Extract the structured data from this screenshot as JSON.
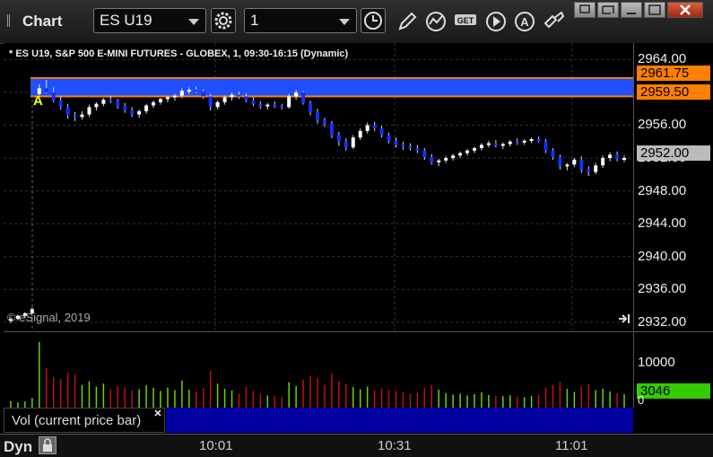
{
  "window": {
    "title": "Chart",
    "symbol": "ES U19",
    "interval": "1"
  },
  "chart": {
    "title": "* ES U19, S&P 500 E-MINI FUTURES - GLOBEX, 1, 09:30-16:15 (Dynamic)",
    "copyright": "© eSignal, 2019",
    "marker": "A",
    "price_ticks": [
      "2964.00",
      "2960.00",
      "2956.00",
      "2952.00",
      "2948.00",
      "2944.00",
      "2940.00",
      "2936.00",
      "2932.00"
    ],
    "zone_high": "2961.75",
    "zone_low": "2959.50",
    "last_price": "2952.00"
  },
  "volume": {
    "tick": "10000",
    "zero": "0",
    "last_volume": "3046",
    "legend": "Vol (current price bar)"
  },
  "status": {
    "mode": "Dyn",
    "times": [
      "10:01",
      "10:31",
      "11:01"
    ]
  },
  "colors": {
    "zone": "#1f4fff",
    "zone_border": "#ff8000",
    "up_volume": "#6cd400",
    "down_volume": "#c01010",
    "last_price_tag": "#bbbbbb",
    "volume_tag": "#33cc00"
  },
  "chart_data": {
    "type": "candlestick",
    "price_range": [
      2931,
      2966
    ],
    "volume_range": [
      0,
      16000
    ],
    "bars": [
      [
        2932.2,
        2932.6,
        2931.9,
        2932.4,
        1500
      ],
      [
        2932.4,
        2932.9,
        2932.2,
        2932.8,
        1200
      ],
      [
        2932.8,
        2933.2,
        2932.5,
        2933.1,
        1400
      ],
      [
        2933.1,
        2933.8,
        2932.9,
        2933.6,
        2200
      ],
      [
        2959.8,
        2961.0,
        2959.6,
        2960.5,
        15000
      ],
      [
        2960.5,
        2961.5,
        2959.9,
        2960.0,
        9000
      ],
      [
        2960.0,
        2960.6,
        2958.8,
        2959.0,
        7000
      ],
      [
        2959.0,
        2959.5,
        2957.9,
        2958.2,
        6500
      ],
      [
        2958.2,
        2958.6,
        2956.8,
        2957.2,
        8000
      ],
      [
        2957.2,
        2957.6,
        2956.5,
        2957.0,
        7500
      ],
      [
        2957.0,
        2957.7,
        2956.7,
        2957.3,
        5200
      ],
      [
        2957.3,
        2958.5,
        2957.0,
        2958.2,
        6000
      ],
      [
        2958.2,
        2958.8,
        2957.8,
        2958.6,
        4800
      ],
      [
        2958.6,
        2959.3,
        2958.3,
        2959.1,
        5500
      ],
      [
        2959.1,
        2959.6,
        2958.7,
        2958.9,
        4200
      ],
      [
        2958.9,
        2959.2,
        2958.0,
        2958.3,
        5000
      ],
      [
        2958.3,
        2958.7,
        2957.5,
        2957.8,
        4600
      ],
      [
        2957.8,
        2958.2,
        2957.0,
        2957.3,
        3900
      ],
      [
        2957.3,
        2957.9,
        2956.9,
        2957.7,
        4200
      ],
      [
        2957.7,
        2958.6,
        2957.4,
        2958.4,
        5100
      ],
      [
        2958.4,
        2959.0,
        2958.1,
        2958.8,
        4500
      ],
      [
        2958.8,
        2959.3,
        2958.5,
        2959.2,
        3800
      ],
      [
        2959.2,
        2959.6,
        2958.8,
        2959.4,
        4600
      ],
      [
        2959.4,
        2959.8,
        2959.0,
        2959.6,
        4000
      ],
      [
        2959.6,
        2960.5,
        2959.3,
        2960.2,
        6200
      ],
      [
        2960.2,
        2960.6,
        2959.8,
        2960.3,
        4100
      ],
      [
        2960.3,
        2960.7,
        2959.9,
        2960.1,
        3600
      ],
      [
        2960.1,
        2960.4,
        2959.2,
        2959.5,
        4400
      ],
      [
        2959.5,
        2959.8,
        2957.8,
        2958.2,
        8500
      ],
      [
        2958.2,
        2959.0,
        2957.9,
        2958.8,
        5500
      ],
      [
        2958.8,
        2959.6,
        2958.5,
        2959.4,
        4300
      ],
      [
        2959.4,
        2960.0,
        2959.0,
        2959.7,
        3900
      ],
      [
        2959.7,
        2960.1,
        2959.2,
        2959.5,
        3200
      ],
      [
        2959.5,
        2959.9,
        2958.8,
        2959.0,
        4700
      ],
      [
        2959.0,
        2959.4,
        2958.3,
        2958.6,
        3800
      ],
      [
        2958.6,
        2958.9,
        2958.0,
        2958.3,
        3100
      ],
      [
        2958.3,
        2958.7,
        2957.9,
        2958.5,
        2800
      ],
      [
        2958.5,
        2958.9,
        2958.1,
        2958.3,
        2600
      ],
      [
        2958.3,
        2958.6,
        2957.9,
        2958.2,
        2400
      ],
      [
        2958.2,
        2959.8,
        2958.0,
        2959.5,
        5800
      ],
      [
        2959.5,
        2960.3,
        2959.1,
        2960.0,
        4900
      ],
      [
        2960.0,
        2960.2,
        2958.5,
        2958.7,
        6400
      ],
      [
        2958.7,
        2959.0,
        2957.2,
        2957.6,
        7200
      ],
      [
        2957.6,
        2958.0,
        2956.2,
        2956.6,
        6800
      ],
      [
        2956.6,
        2956.9,
        2955.8,
        2956.2,
        5200
      ],
      [
        2956.2,
        2956.5,
        2954.4,
        2954.8,
        7800
      ],
      [
        2954.8,
        2955.2,
        2953.5,
        2954.0,
        6100
      ],
      [
        2954.0,
        2954.4,
        2952.9,
        2953.3,
        5400
      ],
      [
        2953.3,
        2954.8,
        2953.1,
        2954.5,
        4700
      ],
      [
        2954.5,
        2955.6,
        2954.2,
        2955.3,
        4200
      ],
      [
        2955.3,
        2956.3,
        2955.0,
        2956.0,
        4800
      ],
      [
        2956.0,
        2956.4,
        2955.3,
        2955.6,
        3900
      ],
      [
        2955.6,
        2955.9,
        2954.5,
        2954.8,
        4400
      ],
      [
        2954.8,
        2955.1,
        2953.8,
        2954.1,
        4100
      ],
      [
        2954.1,
        2954.5,
        2953.3,
        2953.6,
        3800
      ],
      [
        2953.6,
        2954.0,
        2953.0,
        2953.4,
        3500
      ],
      [
        2953.4,
        2953.8,
        2952.9,
        2953.2,
        3200
      ],
      [
        2953.2,
        2953.6,
        2952.6,
        2952.9,
        3400
      ],
      [
        2952.9,
        2953.2,
        2951.8,
        2952.1,
        4500
      ],
      [
        2952.1,
        2952.5,
        2951.2,
        2951.5,
        5200
      ],
      [
        2951.5,
        2951.9,
        2951.0,
        2951.7,
        4100
      ],
      [
        2951.7,
        2952.2,
        2951.4,
        2952.0,
        3300
      ],
      [
        2952.0,
        2952.5,
        2951.7,
        2952.3,
        3000
      ],
      [
        2952.3,
        2952.8,
        2952.0,
        2952.6,
        3200
      ],
      [
        2952.6,
        2953.1,
        2952.3,
        2952.9,
        2800
      ],
      [
        2952.9,
        2953.4,
        2952.6,
        2953.2,
        3100
      ],
      [
        2953.2,
        2953.8,
        2952.9,
        2953.6,
        3500
      ],
      [
        2953.6,
        2954.1,
        2953.3,
        2953.8,
        2900
      ],
      [
        2953.8,
        2954.2,
        2953.3,
        2953.5,
        2700
      ],
      [
        2953.5,
        2953.9,
        2953.1,
        2953.7,
        2600
      ],
      [
        2953.7,
        2954.2,
        2953.4,
        2954.0,
        2800
      ],
      [
        2954.0,
        2954.4,
        2953.6,
        2953.9,
        2500
      ],
      [
        2953.9,
        2954.3,
        2953.6,
        2954.1,
        2400
      ],
      [
        2954.1,
        2954.5,
        2953.8,
        2954.3,
        2700
      ],
      [
        2954.3,
        2954.6,
        2953.9,
        2954.0,
        2900
      ],
      [
        2954.0,
        2954.3,
        2952.6,
        2952.9,
        4600
      ],
      [
        2952.9,
        2953.2,
        2951.8,
        2952.1,
        5200
      ],
      [
        2952.1,
        2952.4,
        2950.6,
        2951.0,
        5900
      ],
      [
        2951.0,
        2951.4,
        2950.5,
        2951.2,
        4300
      ],
      [
        2951.2,
        2952.0,
        2950.9,
        2951.8,
        3600
      ],
      [
        2951.8,
        2952.2,
        2950.2,
        2950.6,
        4800
      ],
      [
        2950.6,
        2951.0,
        2949.8,
        2950.3,
        5400
      ],
      [
        2950.3,
        2951.4,
        2950.0,
        2951.1,
        4000
      ],
      [
        2951.1,
        2952.3,
        2950.8,
        2952.0,
        4300
      ],
      [
        2952.0,
        2952.7,
        2951.6,
        2952.4,
        3700
      ],
      [
        2952.4,
        2952.8,
        2951.6,
        2951.9,
        3300
      ],
      [
        2951.9,
        2952.3,
        2951.5,
        2952.0,
        3046
      ]
    ]
  }
}
